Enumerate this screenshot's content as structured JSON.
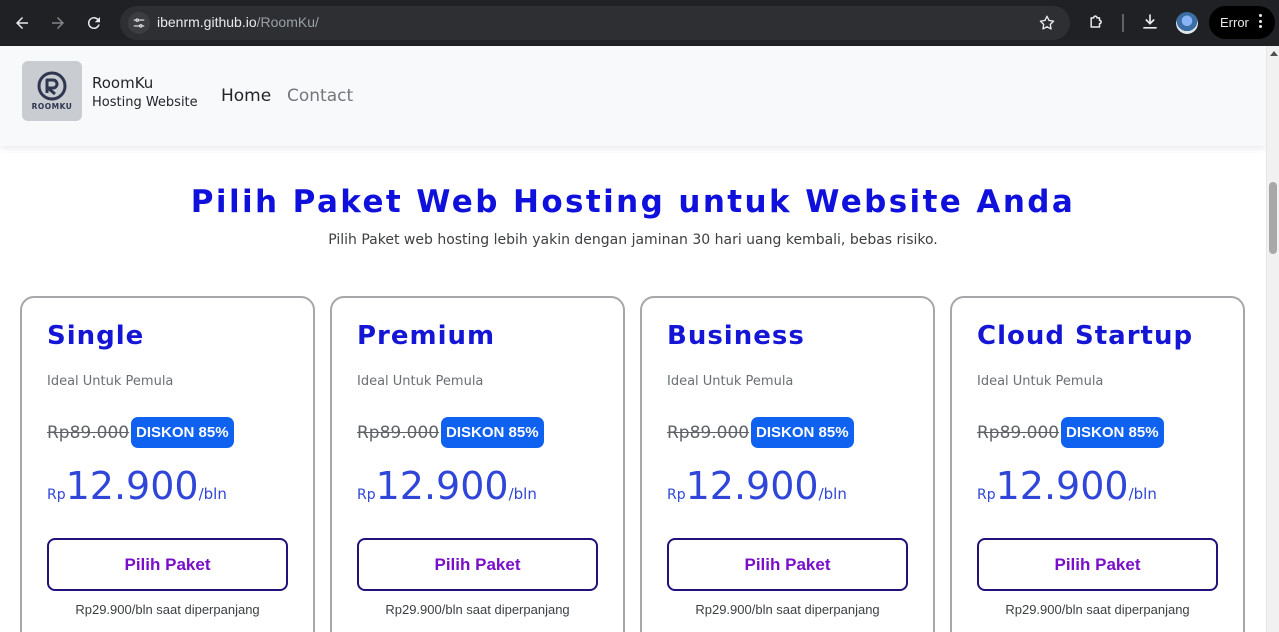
{
  "browser": {
    "url_host": "ibenrm.github.io",
    "url_path": "/RoomKu/",
    "error_label": "Error"
  },
  "site": {
    "logo_text": "ROOMKU",
    "brand_name": "RoomKu",
    "brand_subtitle": "Hosting Website",
    "nav": [
      {
        "label": "Home",
        "active": true
      },
      {
        "label": "Contact",
        "active": false
      }
    ]
  },
  "hero": {
    "title": "Pilih Paket Web Hosting untuk Website Anda",
    "subtitle": "Pilih Paket web hosting lebih yakin dengan jaminan 30 hari uang kembali, bebas risiko."
  },
  "plans": [
    {
      "name": "Single",
      "tagline": "Ideal Untuk Pemula",
      "old_price": "Rp89.000",
      "discount": "DISKON 85%",
      "currency": "Rp",
      "price": "12.900",
      "period": "/bln",
      "button": "Pilih Paket",
      "renewal": "Rp29.900/bln saat diperpanjang"
    },
    {
      "name": "Premium",
      "tagline": "Ideal Untuk Pemula",
      "old_price": "Rp89.000",
      "discount": "DISKON 85%",
      "currency": "Rp",
      "price": "12.900",
      "period": "/bln",
      "button": "Pilih Paket",
      "renewal": "Rp29.900/bln saat diperpanjang"
    },
    {
      "name": "Business",
      "tagline": "Ideal Untuk Pemula",
      "old_price": "Rp89.000",
      "discount": "DISKON 85%",
      "currency": "Rp",
      "price": "12.900",
      "period": "/bln",
      "button": "Pilih Paket",
      "renewal": "Rp29.900/bln saat diperpanjang"
    },
    {
      "name": "Cloud Startup",
      "tagline": "Ideal Untuk Pemula",
      "old_price": "Rp89.000",
      "discount": "DISKON 85%",
      "currency": "Rp",
      "price": "12.900",
      "period": "/bln",
      "button": "Pilih Paket",
      "renewal": "Rp29.900/bln saat diperpanjang"
    }
  ],
  "colors": {
    "heading_blue": "#1010dd",
    "badge_blue": "#0f62f0",
    "price_blue": "#2f46d8",
    "button_text": "#7a0fc9",
    "button_border": "#24107a"
  },
  "icons": {
    "back": "arrow-left-icon",
    "forward": "arrow-right-icon",
    "reload": "reload-icon",
    "site_info": "tune-icon",
    "bookmark": "star-icon",
    "extensions": "puzzle-icon",
    "downloads": "download-icon",
    "menu": "kebab-menu-icon"
  }
}
